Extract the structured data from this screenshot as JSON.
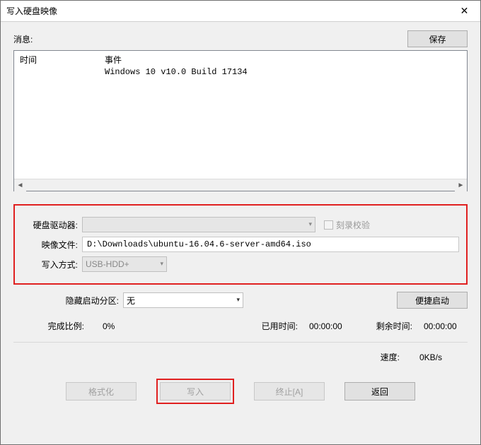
{
  "window": {
    "title": "写入硬盘映像"
  },
  "message": {
    "label": "消息:",
    "save_btn": "保存"
  },
  "log": {
    "col_time": "时间",
    "col_event": "事件",
    "rows": [
      {
        "time": "",
        "event": "Windows 10 v10.0 Build 17134"
      }
    ]
  },
  "form": {
    "drive_label": "硬盘驱动器:",
    "drive_value": "",
    "verify_label": "刻录校验",
    "image_label": "映像文件:",
    "image_value": "D:\\Downloads\\ubuntu-16.04.6-server-amd64.iso",
    "method_label": "写入方式:",
    "method_value": "USB-HDD+"
  },
  "hidden": {
    "label": "隐藏启动分区:",
    "value": "无",
    "quickboot_btn": "便捷启动"
  },
  "stats": {
    "progress_label": "完成比例:",
    "progress_value": "0%",
    "elapsed_label": "已用时间:",
    "elapsed_value": "00:00:00",
    "remain_label": "剩余时间:",
    "remain_value": "00:00:00",
    "speed_label": "速度:",
    "speed_value": "0KB/s"
  },
  "actions": {
    "format": "格式化",
    "write": "写入",
    "abort": "终止[A]",
    "return": "返回"
  }
}
